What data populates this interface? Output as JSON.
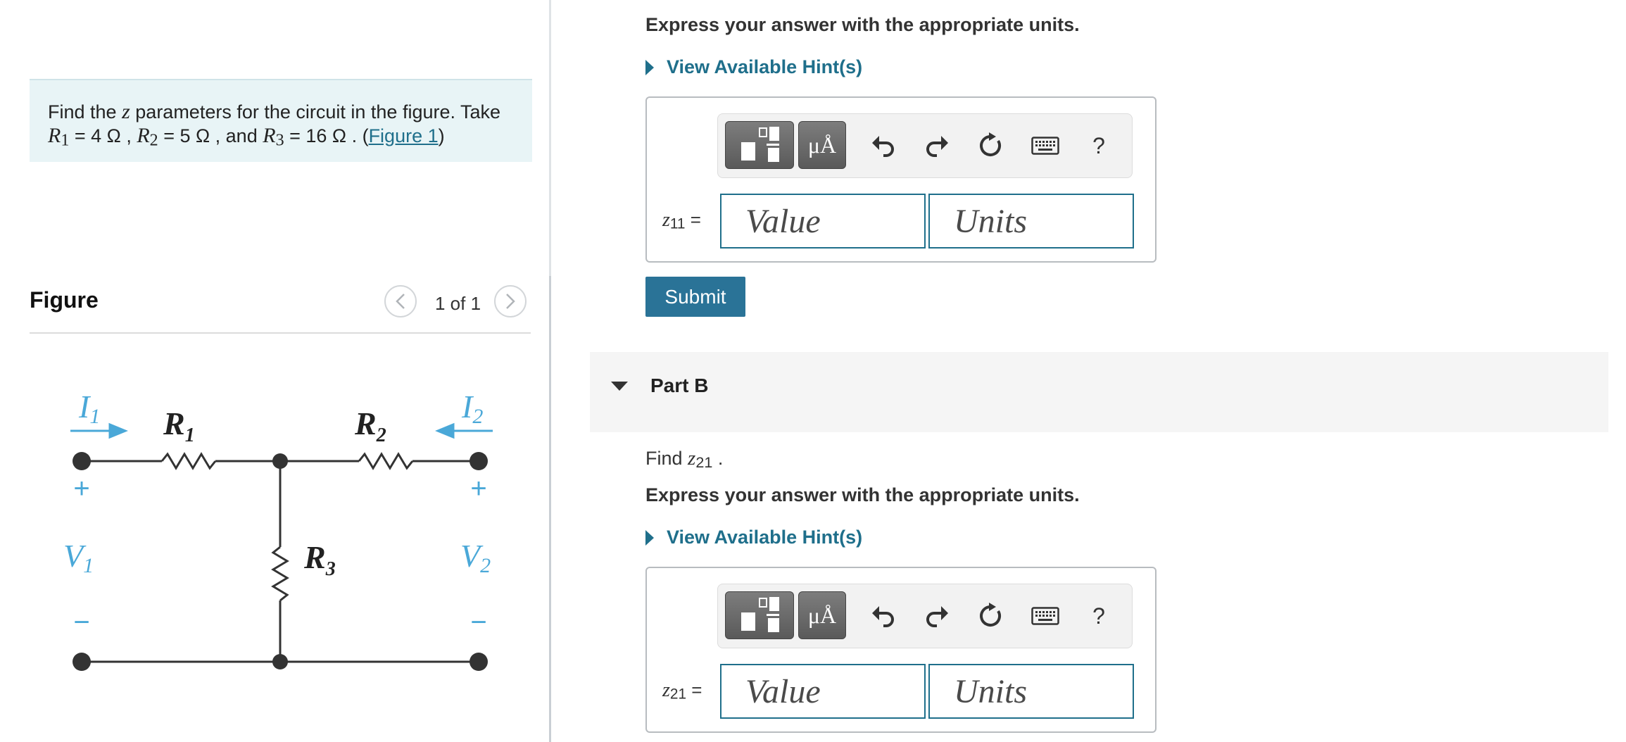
{
  "problem": {
    "text_before": "Find the",
    "var_z": "z",
    "text_after": "parameters for the circuit in the figure. Take",
    "r1_label": "R",
    "r1_sub": "1",
    "r1_value": "= 4 Ω ,",
    "r2_label": "R",
    "r2_sub": "2",
    "r2_value": "= 5 Ω , and",
    "r3_label": "R",
    "r3_sub": "3",
    "r3_value": "= 16 Ω . (",
    "figure_link": "Figure 1",
    "close_paren": ")"
  },
  "figure": {
    "title": "Figure",
    "page_counter": "1 of 1",
    "circuit_labels": {
      "I1": "I",
      "I1_sub": "1",
      "I2": "I",
      "I2_sub": "2",
      "R1": "R",
      "R1_sub": "1",
      "R2": "R",
      "R2_sub": "2",
      "R3": "R",
      "R3_sub": "3",
      "V1": "V",
      "V1_sub": "1",
      "V2": "V",
      "V2_sub": "2",
      "plus": "+",
      "minus": "−"
    }
  },
  "part_a": {
    "instruction": "Express your answer with the appropriate units.",
    "hint_label": "View Available Hint(s)",
    "variable": "z",
    "variable_sub": "11",
    "equals": "=",
    "value_placeholder": "Value",
    "units_placeholder": "Units",
    "toolbar_mu": "μÅ",
    "toolbar_help": "?",
    "submit_label": "Submit"
  },
  "part_b": {
    "title": "Part B",
    "find_prefix": "Find",
    "find_var": "z",
    "find_sub": "21",
    "find_suffix": ".",
    "instruction": "Express your answer with the appropriate units.",
    "hint_label": "View Available Hint(s)",
    "variable": "z",
    "variable_sub": "21",
    "equals": "=",
    "value_placeholder": "Value",
    "units_placeholder": "Units",
    "toolbar_mu": "μÅ",
    "toolbar_help": "?"
  },
  "colors": {
    "accent": "#1f6f8b",
    "submit": "#2a7397",
    "circuit_blue": "#4aa8d8",
    "problem_bg": "#e8f4f6"
  }
}
